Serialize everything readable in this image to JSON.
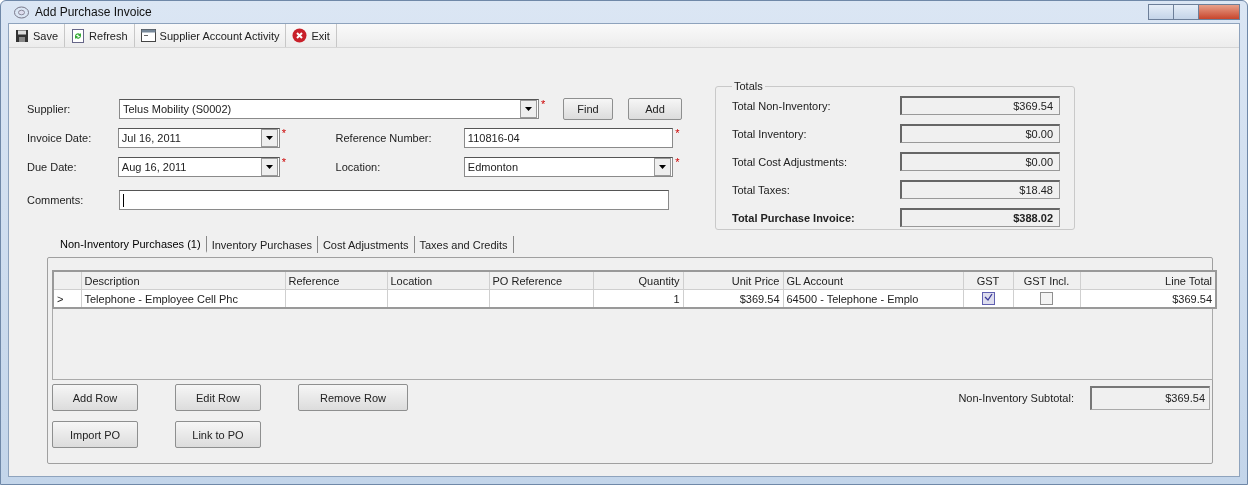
{
  "window": {
    "title": "Add Purchase Invoice"
  },
  "toolbar": [
    {
      "label": "Save",
      "kind": "save"
    },
    {
      "label": "Refresh",
      "kind": "refresh"
    },
    {
      "label": "Supplier Account Activity",
      "kind": "activity"
    },
    {
      "label": "Exit",
      "kind": "exit"
    }
  ],
  "form": {
    "supplier": {
      "label": "Supplier:",
      "value": "Telus Mobility (S0002)",
      "required_mark": "*"
    },
    "find_button": "Find",
    "add_button": "Add",
    "invoice_date": {
      "label": "Invoice Date:",
      "value": "Jul  16, 2011",
      "required_mark": "*"
    },
    "reference_number": {
      "label": "Reference Number:",
      "value": "110816-04",
      "required_mark": "*"
    },
    "due_date": {
      "label": "Due Date:",
      "value": "Aug 16, 2011",
      "required_mark": "*"
    },
    "location": {
      "label": "Location:",
      "value": "Edmonton",
      "required_mark": "*"
    },
    "comments": {
      "label": "Comments:"
    }
  },
  "totals": {
    "title": "Totals",
    "rows": [
      {
        "label": "Total Non-Inventory:",
        "value": "$369.54",
        "bold": false
      },
      {
        "label": "Total Inventory:",
        "value": "$0.00",
        "bold": false
      },
      {
        "label": "Total Cost Adjustments:",
        "value": "$0.00",
        "bold": false
      },
      {
        "label": "Total Taxes:",
        "value": "$18.48",
        "bold": false
      },
      {
        "label": "Total Purchase Invoice:",
        "value": "$388.02",
        "bold": true
      }
    ]
  },
  "tabs": [
    {
      "label": "Non-Inventory Purchases (1)",
      "selected": true
    },
    {
      "label": "Inventory Purchases",
      "selected": false
    },
    {
      "label": "Cost Adjustments",
      "selected": false
    },
    {
      "label": "Taxes and Credits",
      "selected": false
    }
  ],
  "grid": {
    "columns": [
      {
        "label": "Description",
        "kind": "text"
      },
      {
        "label": "Reference",
        "kind": "text"
      },
      {
        "label": "Location",
        "kind": "text"
      },
      {
        "label": "PO Reference",
        "kind": "text"
      },
      {
        "label": "Quantity",
        "kind": "number"
      },
      {
        "label": "Unit Price",
        "kind": "number"
      },
      {
        "label": "GL Account",
        "kind": "text"
      },
      {
        "label": "GST",
        "kind": "check"
      },
      {
        "label": "GST Incl.",
        "kind": "check"
      },
      {
        "label": "Line Total",
        "kind": "number"
      }
    ],
    "rows": [
      {
        "marker": ">",
        "cells": [
          "Telephone - Employee Cell Phc",
          null,
          null,
          null,
          "1",
          "$369.54",
          "64500 - Telephone - Emplo",
          true,
          false,
          "$369.54"
        ]
      }
    ]
  },
  "row_buttons": [
    [
      "Add Row",
      "Edit Row",
      "Remove Row"
    ],
    [
      "Import PO",
      "Link to PO"
    ]
  ],
  "subtotal": {
    "label": "Non-Inventory Subtotal:",
    "value": "$369.54"
  }
}
